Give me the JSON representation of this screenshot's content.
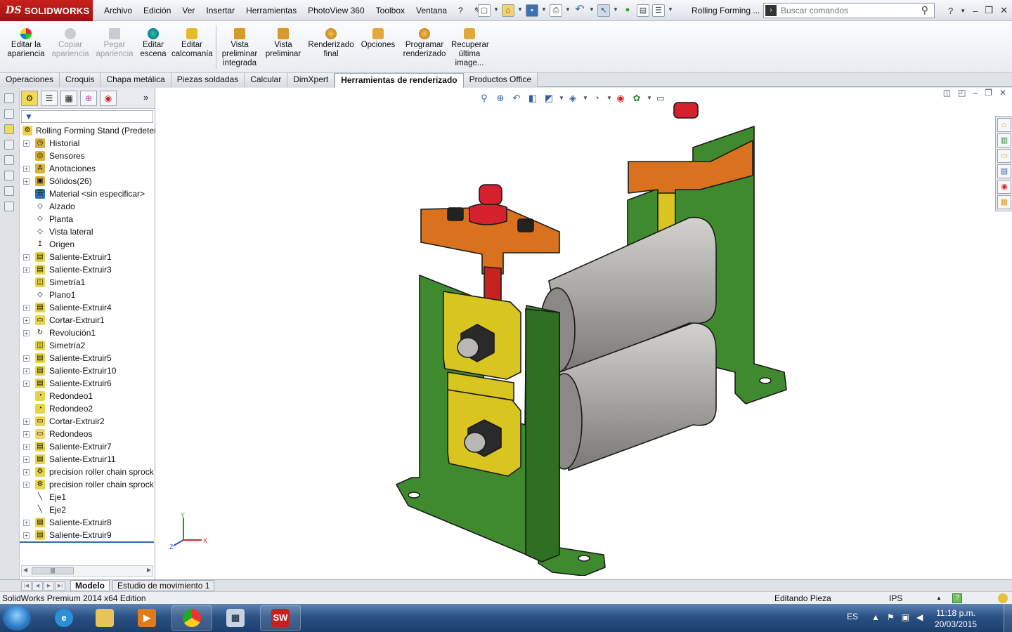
{
  "app": {
    "logo_text": "SOLIDWORKS",
    "logo_prefix": "DS",
    "document_title": "Rolling Forming ..."
  },
  "menu": [
    "Archivo",
    "Edición",
    "Ver",
    "Insertar",
    "Herramientas",
    "PhotoView 360",
    "Toolbox",
    "Ventana",
    "?"
  ],
  "search": {
    "placeholder": "Buscar comandos"
  },
  "ribbon": {
    "buttons": [
      {
        "label": "Editar la apariencia",
        "enabled": true,
        "icon": "appearance-icon"
      },
      {
        "label": "Copiar apariencia",
        "enabled": false,
        "icon": "copy-appearance-icon"
      },
      {
        "label": "Pegar apariencia",
        "enabled": false,
        "icon": "paste-appearance-icon"
      },
      {
        "label": "Editar escena",
        "enabled": true,
        "icon": "scene-icon"
      },
      {
        "label": "Editar calcomanía",
        "enabled": true,
        "icon": "decal-icon"
      },
      {
        "label": "Vista preliminar integrada",
        "enabled": true,
        "icon": "integrated-preview-icon"
      },
      {
        "label": "Vista preliminar",
        "enabled": true,
        "icon": "preview-window-icon"
      },
      {
        "label": "Renderizado final",
        "enabled": true,
        "icon": "final-render-icon"
      },
      {
        "label": "Opciones",
        "enabled": true,
        "icon": "options-icon"
      },
      {
        "label": "Programar renderizado",
        "enabled": true,
        "icon": "schedule-render-icon"
      },
      {
        "label": "Recuperar última image...",
        "enabled": true,
        "icon": "recall-image-icon"
      }
    ]
  },
  "tabs": [
    {
      "label": "Operaciones",
      "active": false
    },
    {
      "label": "Croquis",
      "active": false
    },
    {
      "label": "Chapa metálica",
      "active": false
    },
    {
      "label": "Piezas soldadas",
      "active": false
    },
    {
      "label": "Calcular",
      "active": false
    },
    {
      "label": "DimXpert",
      "active": false
    },
    {
      "label": "Herramientas de renderizado",
      "active": true
    },
    {
      "label": "Productos Office",
      "active": false
    }
  ],
  "feature_tree": {
    "root": "Rolling Forming Stand  (Predetermi...",
    "items": [
      {
        "label": "Historial",
        "expandable": true,
        "icon": "history-icon",
        "color": "#d9b23a"
      },
      {
        "label": "Sensores",
        "expandable": false,
        "icon": "sensor-icon",
        "color": "#d9b23a"
      },
      {
        "label": "Anotaciones",
        "expandable": true,
        "icon": "annotations-icon",
        "color": "#d9b23a"
      },
      {
        "label": "Sólidos(26)",
        "expandable": true,
        "icon": "solid-bodies-icon",
        "color": "#d9b23a"
      },
      {
        "label": "Material <sin especificar>",
        "expandable": false,
        "icon": "material-icon",
        "color": "#2f6fb0"
      },
      {
        "label": "Alzado",
        "expandable": false,
        "icon": "plane-icon",
        "color": "#ffffff"
      },
      {
        "label": "Planta",
        "expandable": false,
        "icon": "plane-icon",
        "color": "#ffffff"
      },
      {
        "label": "Vista lateral",
        "expandable": false,
        "icon": "plane-icon",
        "color": "#ffffff"
      },
      {
        "label": "Origen",
        "expandable": false,
        "icon": "origin-icon",
        "color": "#ffffff"
      },
      {
        "label": "Saliente-Extruir1",
        "expandable": true,
        "icon": "extrude-icon",
        "color": "#e8d44a"
      },
      {
        "label": "Saliente-Extruir3",
        "expandable": true,
        "icon": "extrude-icon",
        "color": "#e8d44a"
      },
      {
        "label": "Simetría1",
        "expandable": false,
        "icon": "mirror-icon",
        "color": "#e8d44a"
      },
      {
        "label": "Plano1",
        "expandable": false,
        "icon": "plane-icon",
        "color": "#ffffff"
      },
      {
        "label": "Saliente-Extruir4",
        "expandable": true,
        "icon": "extrude-icon",
        "color": "#e8d44a"
      },
      {
        "label": "Cortar-Extruir1",
        "expandable": true,
        "icon": "cut-extrude-icon",
        "color": "#e8d44a"
      },
      {
        "label": "Revolución1",
        "expandable": true,
        "icon": "revolve-icon",
        "color": "#ffffff"
      },
      {
        "label": "Simetría2",
        "expandable": false,
        "icon": "mirror-icon",
        "color": "#e8d44a"
      },
      {
        "label": "Saliente-Extruir5",
        "expandable": true,
        "icon": "extrude-icon",
        "color": "#e8d44a"
      },
      {
        "label": "Saliente-Extruir10",
        "expandable": true,
        "icon": "extrude-icon",
        "color": "#e8d44a"
      },
      {
        "label": "Saliente-Extruir6",
        "expandable": true,
        "icon": "extrude-icon",
        "color": "#e8d44a"
      },
      {
        "label": "Redondeo1",
        "expandable": false,
        "icon": "fillet-icon",
        "color": "#e8d44a"
      },
      {
        "label": "Redondeo2",
        "expandable": false,
        "icon": "fillet-icon",
        "color": "#e8d44a"
      },
      {
        "label": "Cortar-Extruir2",
        "expandable": true,
        "icon": "cut-extrude-icon",
        "color": "#e8d44a"
      },
      {
        "label": "Redondeos",
        "expandable": true,
        "icon": "folder-icon",
        "color": "#f2d56a"
      },
      {
        "label": "Saliente-Extruir7",
        "expandable": true,
        "icon": "extrude-icon",
        "color": "#e8d44a"
      },
      {
        "label": "Saliente-Extruir11",
        "expandable": true,
        "icon": "extrude-icon",
        "color": "#e8d44a"
      },
      {
        "label": "precision roller chain sprock",
        "expandable": true,
        "icon": "library-feature-icon",
        "color": "#e8d44a"
      },
      {
        "label": "precision roller chain sprock",
        "expandable": true,
        "icon": "library-feature-icon",
        "color": "#e8d44a"
      },
      {
        "label": "Eje1",
        "expandable": false,
        "icon": "axis-icon",
        "color": "#ffffff"
      },
      {
        "label": "Eje2",
        "expandable": false,
        "icon": "axis-icon",
        "color": "#ffffff"
      },
      {
        "label": "Saliente-Extruir8",
        "expandable": true,
        "icon": "extrude-icon",
        "color": "#e8d44a"
      },
      {
        "label": "Saliente-Extruir9",
        "expandable": true,
        "icon": "extrude-icon",
        "color": "#e8d44a"
      }
    ]
  },
  "triad": {
    "x": "X",
    "y": "Y",
    "z": "Z"
  },
  "bottom_tabs": [
    {
      "label": "Modelo",
      "active": true
    },
    {
      "label": "Estudio de movimiento 1",
      "active": false
    }
  ],
  "status": {
    "edition": "SolidWorks Premium 2014 x64 Edition",
    "mode": "Editando Pieza",
    "units": "IPS",
    "help_icon": "?"
  },
  "taskbar": {
    "apps": [
      "ie-icon",
      "explorer-icon",
      "media-player-icon",
      "chrome-icon",
      "calculator-icon",
      "solidworks-icon"
    ],
    "language": "ES",
    "time": "11:18 p.m.",
    "date": "20/03/2015"
  },
  "colors": {
    "frame_green": "#3f8a2f",
    "cap_orange": "#d9711f",
    "bearing_yellow": "#d8c51f",
    "roller_gray": "#a8a6a2",
    "knob_red": "#d5212e",
    "logo_red": "#b21a18"
  }
}
